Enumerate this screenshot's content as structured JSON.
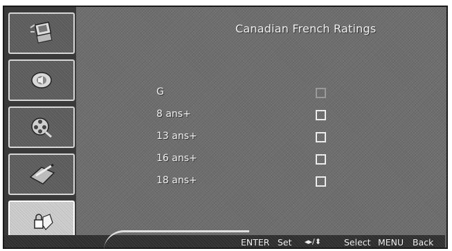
{
  "screen": {
    "title": "Canadian French Ratings"
  },
  "sidebar": {
    "items": [
      {
        "name": "setup-menu-tab",
        "icon": "monitor-setup-icon",
        "active": false
      },
      {
        "name": "audio-menu-tab",
        "icon": "speaker-icon",
        "active": false
      },
      {
        "name": "video-menu-tab",
        "icon": "film-reel-icon",
        "active": false
      },
      {
        "name": "option-menu-tab",
        "icon": "pencil-pad-icon",
        "active": false
      },
      {
        "name": "lock-menu-tab",
        "icon": "lock-hand-icon",
        "active": true
      }
    ]
  },
  "ratings": [
    {
      "label": "G",
      "checked": false,
      "enabled": false
    },
    {
      "label": "8 ans+",
      "checked": false,
      "enabled": true
    },
    {
      "label": "13 ans+",
      "checked": false,
      "enabled": true
    },
    {
      "label": "16 ans+",
      "checked": false,
      "enabled": true
    },
    {
      "label": "18 ans+",
      "checked": false,
      "enabled": true
    }
  ],
  "footer": {
    "enter_key": "ENTER",
    "enter_action": "Set",
    "nav_keys": "◂▸/⬍",
    "nav_action": "Select",
    "menu_key": "MENU",
    "menu_action": "Back"
  },
  "colors": {
    "panel": "#6f6f6f",
    "sidebar": "#3a3a3a",
    "active_tab": "#cfcfcf",
    "text": "#f0f0f0"
  }
}
